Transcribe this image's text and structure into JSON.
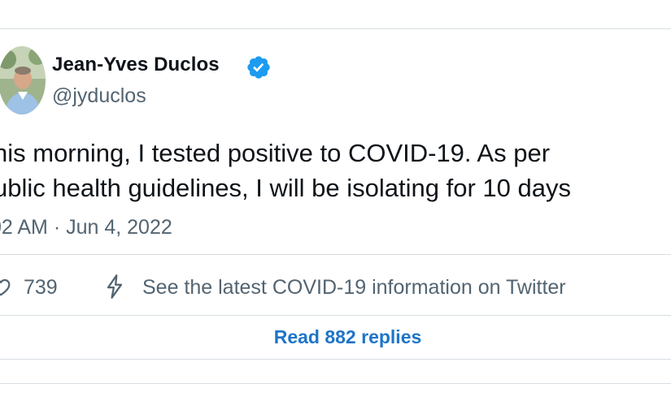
{
  "author": {
    "display_name": "Jean-Yves Duclos",
    "handle": "@jyduclos",
    "verified": true
  },
  "tweet": {
    "lines": [
      "his morning, I tested positive to COVID-19. As per",
      "ublic health guidelines, I will be isolating for 10 days"
    ],
    "timestamp": "02 AM · Jun 4, 2022"
  },
  "actions": {
    "like_count": "739",
    "covid_info_label": "See the latest COVID-19 information on Twitter"
  },
  "footer": {
    "read_replies_label": "Read 882 replies"
  },
  "icons": {
    "verified": "verified-badge-icon",
    "like": "heart-icon",
    "covid_info": "lightning-bolt-icon"
  },
  "colors": {
    "text_primary": "#0f1419",
    "text_secondary": "#536471",
    "link_blue": "#1d75c9",
    "verified_blue": "#1d9bf0",
    "divider": "#d6dde2"
  }
}
